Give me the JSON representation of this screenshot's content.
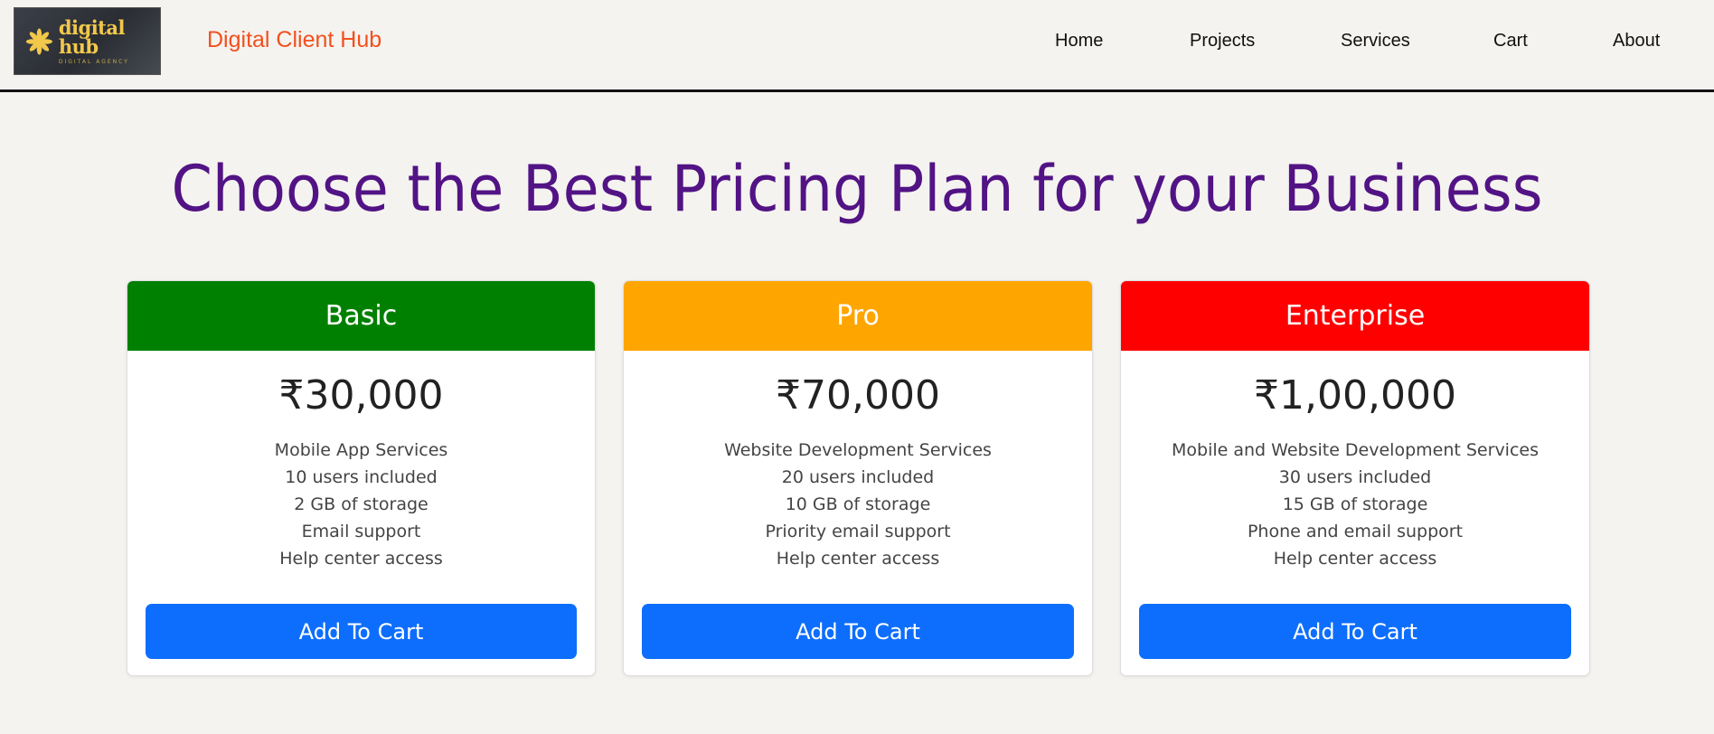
{
  "header": {
    "logo_text": "digital hub",
    "logo_subtext": "DIGITAL AGENCY",
    "brand": "Digital Client Hub",
    "nav": [
      "Home",
      "Projects",
      "Services",
      "Cart",
      "About"
    ]
  },
  "main": {
    "headline": "Choose the Best Pricing Plan for your Business",
    "plans": [
      {
        "name": "Basic",
        "color": "#008000",
        "price": "₹30,000",
        "features": [
          "Mobile App Services",
          "10 users included",
          "2 GB of storage",
          "Email support",
          "Help center access"
        ],
        "button": "Add To Cart"
      },
      {
        "name": "Pro",
        "color": "#ffa500",
        "price": "₹70,000",
        "features": [
          "Website Development Services",
          "20 users included",
          "10 GB of storage",
          "Priority email support",
          "Help center access"
        ],
        "button": "Add To Cart"
      },
      {
        "name": "Enterprise",
        "color": "#ff0000",
        "price": "₹1,00,000",
        "features": [
          "Mobile and Website Development Services",
          "30 users included",
          "15 GB of storage",
          "Phone and email support",
          "Help center access"
        ],
        "button": "Add To Cart"
      }
    ]
  },
  "colors": {
    "brand": "#f2501e",
    "headline": "#521385",
    "button": "#0d6efd",
    "background": "#f4f3ef"
  }
}
